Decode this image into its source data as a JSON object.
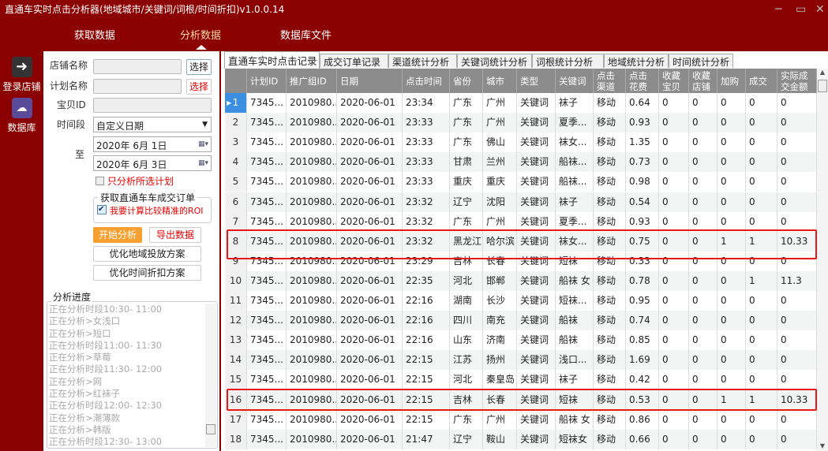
{
  "title": "直通车实时点击分析器(地域城市/关键词/词根/时间折扣)v1.0.0.14",
  "window": {
    "minimize": "─",
    "maximize": "▭",
    "close": "✕"
  },
  "nav": [
    "获取数据",
    "分析数据",
    "数据库文件"
  ],
  "sidebar": [
    {
      "label": "登录店铺"
    },
    {
      "label": "数据库"
    }
  ],
  "form": {
    "shop_label": "店铺名称",
    "plan_label": "计划名称",
    "item_label": "宝贝ID",
    "period_label": "时间段",
    "to_label": "至",
    "select": "选择",
    "period_value": "自定义日期",
    "date_from": "2020年  6月  1日",
    "date_to": "2020年  6月  3日",
    "only_selected": "只分析所选计划",
    "group_title": "获取直通车车成交订单",
    "roi_label": "我要计算比较精准的ROI",
    "start": "开始分析",
    "export": "导出数据",
    "opt_region": "优化地域投放方案",
    "opt_time": "优化时间折扣方案"
  },
  "progress": {
    "title": "分析进度",
    "lines": [
      "正在分析时段10:30- 11:00",
      "正在分析>女浅口",
      "正在分析>短口",
      "正在分析时段11:00- 11:30",
      "正在分析>草莓",
      "正在分析时段11:30- 12:00",
      "正在分析>网",
      "正在分析>红袜子",
      "正在分析时段12:00- 12:30",
      "正在分析>潮薄款",
      "正在分析>韩版",
      "正在分析时段12:30- 13:00"
    ]
  },
  "tabs": [
    "直通车实时点击记录",
    "成交订单记录",
    "渠道统计分析",
    "关键词统计分析",
    "词根统计分析",
    "地域统计分析",
    "时间统计分析"
  ],
  "columns": [
    "",
    "计划ID",
    "推广组ID",
    "日期",
    "点击时间",
    "省份",
    "城市",
    "类型",
    "关键词",
    "点击\n渠道",
    "点击\n花费",
    "收藏\n宝贝",
    "收藏\n店铺",
    "加购",
    "成交",
    "实际成\n交金额"
  ],
  "rows": [
    [
      "1",
      "7345...",
      "2010980...",
      "2020-06-01",
      "23:34",
      "广东",
      "广州",
      "关键词",
      "袜子",
      "移动",
      "0.64",
      "0",
      "0",
      "0",
      "0",
      "0"
    ],
    [
      "2",
      "7345...",
      "2010980...",
      "2020-06-01",
      "23:33",
      "广东",
      "广州",
      "关键词",
      "夏季...",
      "移动",
      "0.93",
      "0",
      "0",
      "0",
      "0",
      "0"
    ],
    [
      "3",
      "7345...",
      "2010980...",
      "2020-06-01",
      "23:33",
      "广东",
      "佛山",
      "关键词",
      "袜女...",
      "移动",
      "1.35",
      "0",
      "0",
      "0",
      "0",
      "0"
    ],
    [
      "4",
      "7345...",
      "2010980...",
      "2020-06-01",
      "23:33",
      "甘肃",
      "兰州",
      "关键词",
      "船袜...",
      "移动",
      "0.73",
      "0",
      "0",
      "0",
      "0",
      "0"
    ],
    [
      "5",
      "7345...",
      "2010980...",
      "2020-06-01",
      "23:33",
      "重庆",
      "重庆",
      "关键词",
      "船袜...",
      "移动",
      "0.98",
      "0",
      "0",
      "0",
      "0",
      "0"
    ],
    [
      "6",
      "7345...",
      "2010980...",
      "2020-06-01",
      "23:32",
      "辽宁",
      "沈阳",
      "关键词",
      "袜子",
      "移动",
      "0.54",
      "0",
      "0",
      "0",
      "0",
      "0"
    ],
    [
      "7",
      "7345...",
      "2010980...",
      "2020-06-01",
      "23:32",
      "广东",
      "广州",
      "关键词",
      "夏季...",
      "移动",
      "0.93",
      "0",
      "0",
      "0",
      "0",
      "0"
    ],
    [
      "8",
      "7345...",
      "2010980...",
      "2020-06-01",
      "23:32",
      "黑龙江",
      "哈尔滨",
      "关键词",
      "袜女...",
      "移动",
      "0.75",
      "0",
      "0",
      "1",
      "1",
      "10.33"
    ],
    [
      "9",
      "7345...",
      "2010980...",
      "2020-06-01",
      "23:29",
      "吉林",
      "长春",
      "关键词",
      "短袜",
      "移动",
      "0.33",
      "0",
      "0",
      "0",
      "0",
      "0"
    ],
    [
      "10",
      "7345...",
      "2010980...",
      "2020-06-01",
      "22:35",
      "河北",
      "邯郸",
      "关键词",
      "船袜 女",
      "移动",
      "0.78",
      "0",
      "0",
      "0",
      "1",
      "11.3"
    ],
    [
      "11",
      "7345...",
      "2010980...",
      "2020-06-01",
      "22:16",
      "湖南",
      "长沙",
      "关键词",
      "短袜...",
      "移动",
      "0.95",
      "0",
      "0",
      "0",
      "0",
      "0"
    ],
    [
      "12",
      "7345...",
      "2010980...",
      "2020-06-01",
      "22:16",
      "四川",
      "南充",
      "关键词",
      "船袜",
      "移动",
      "0.74",
      "0",
      "0",
      "0",
      "0",
      "0"
    ],
    [
      "13",
      "7345...",
      "2010980...",
      "2020-06-01",
      "22:16",
      "山东",
      "济南",
      "关键词",
      "船袜",
      "移动",
      "0.85",
      "0",
      "0",
      "0",
      "0",
      "0"
    ],
    [
      "14",
      "7345...",
      "2010980...",
      "2020-06-01",
      "22:15",
      "江苏",
      "扬州",
      "关键词",
      "浅口...",
      "移动",
      "1.69",
      "0",
      "0",
      "0",
      "0",
      "0"
    ],
    [
      "15",
      "7345...",
      "2010980...",
      "2020-06-01",
      "22:15",
      "河北",
      "秦皇岛",
      "关键词",
      "袜子",
      "移动",
      "0.42",
      "0",
      "0",
      "0",
      "0",
      "0"
    ],
    [
      "16",
      "7345...",
      "2010980...",
      "2020-06-01",
      "22:15",
      "吉林",
      "长春",
      "关键词",
      "短袜",
      "移动",
      "0.53",
      "0",
      "0",
      "1",
      "1",
      "10.33"
    ],
    [
      "17",
      "7345...",
      "2010980...",
      "2020-06-01",
      "22:15",
      "广东",
      "广州",
      "关键词",
      "船袜 女",
      "移动",
      "0.86",
      "0",
      "0",
      "0",
      "0",
      "0"
    ],
    [
      "18",
      "7345...",
      "2010980...",
      "2020-06-01",
      "21:47",
      "辽宁",
      "鞍山",
      "关键词",
      "短袜女",
      "移动",
      "0.66",
      "0",
      "0",
      "0",
      "0",
      "0"
    ]
  ],
  "highlighted_rows": [
    8,
    16
  ],
  "colors": {
    "brand": "#8b0000",
    "accent": "#f5a030",
    "highlight": "#e81818"
  }
}
